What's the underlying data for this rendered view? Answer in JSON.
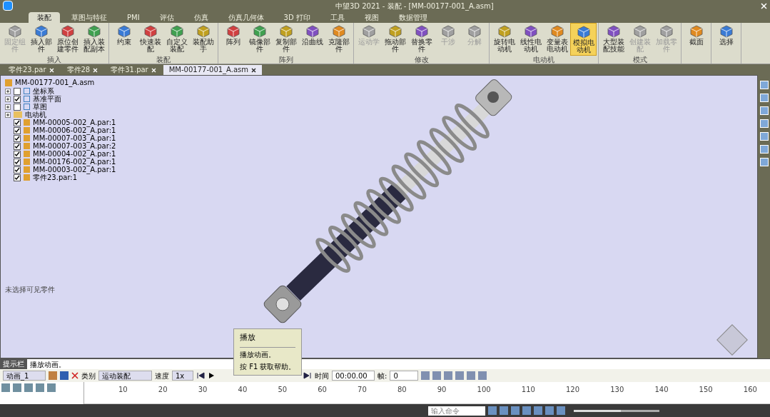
{
  "window": {
    "title": "中望3D 2021 - 装配 - [MM-00177-001_A.asm]"
  },
  "menu_tabs": [
    {
      "label": "装配",
      "selected": true
    },
    {
      "label": "草图与特征",
      "selected": false
    },
    {
      "label": "PMI",
      "selected": false
    },
    {
      "label": "评估",
      "selected": false
    },
    {
      "label": "仿真",
      "selected": false
    },
    {
      "label": "仿真几何体",
      "selected": false
    },
    {
      "label": "3D 打印",
      "selected": false
    },
    {
      "label": "工具",
      "selected": false
    },
    {
      "label": "视图",
      "selected": false
    },
    {
      "label": "数据管理",
      "selected": false
    }
  ],
  "ribbon_groups": [
    {
      "label": "插入",
      "buttons": [
        {
          "label": "固定组件",
          "disabled": true,
          "active": false
        },
        {
          "label": "插入部件",
          "disabled": false,
          "active": false
        },
        {
          "label": "原位创建零件",
          "disabled": false,
          "active": false
        },
        {
          "label": "插入装配副本",
          "disabled": false,
          "active": false
        }
      ]
    },
    {
      "label": "装配",
      "buttons": [
        {
          "label": "约束",
          "disabled": false,
          "active": false
        },
        {
          "label": "快速装配",
          "disabled": false,
          "active": false
        },
        {
          "label": "自定义装配",
          "disabled": false,
          "active": false
        },
        {
          "label": "装配助手",
          "disabled": false,
          "active": false
        }
      ]
    },
    {
      "label": "阵列",
      "buttons": [
        {
          "label": "阵列",
          "disabled": false,
          "active": false
        },
        {
          "label": "镜像部件",
          "disabled": false,
          "active": false
        },
        {
          "label": "复制部件",
          "disabled": false,
          "active": false
        },
        {
          "label": "沿曲线",
          "disabled": false,
          "active": false
        },
        {
          "label": "克隆部件",
          "disabled": false,
          "active": false
        }
      ]
    },
    {
      "label": "修改",
      "buttons": [
        {
          "label": "运动学",
          "disabled": true,
          "active": false
        },
        {
          "label": "拖动部件",
          "disabled": false,
          "active": false
        },
        {
          "label": "替换零件",
          "disabled": false,
          "active": false
        },
        {
          "label": "干涉",
          "disabled": true,
          "active": false
        },
        {
          "label": "分解",
          "disabled": true,
          "active": false
        }
      ]
    },
    {
      "label": "电动机",
      "buttons": [
        {
          "label": "旋转电动机",
          "disabled": false,
          "active": false
        },
        {
          "label": "线性电动机",
          "disabled": false,
          "active": false
        },
        {
          "label": "变量表电动机",
          "disabled": false,
          "active": false
        },
        {
          "label": "模拟电动机",
          "disabled": false,
          "active": true
        }
      ]
    },
    {
      "label": "模式",
      "buttons": [
        {
          "label": "大型装配技能",
          "disabled": false,
          "active": false
        },
        {
          "label": "创建装配",
          "disabled": true,
          "active": false
        },
        {
          "label": "加载零件",
          "disabled": true,
          "active": false
        }
      ]
    },
    {
      "buttons": [
        {
          "label": "截面",
          "disabled": false,
          "active": false
        }
      ]
    },
    {
      "buttons": [
        {
          "label": "选择",
          "disabled": false,
          "active": false
        }
      ]
    }
  ],
  "documents": [
    {
      "label": "零件23.par",
      "selected": false
    },
    {
      "label": "零件28",
      "selected": false
    },
    {
      "label": "零件31.par",
      "selected": false
    },
    {
      "label": "MM-00177-001_A.asm",
      "selected": true
    }
  ],
  "tree": {
    "label": "MM-00177-001_A.asm",
    "children": [
      {
        "label": "坐标系",
        "kind": "feature",
        "checked": false
      },
      {
        "label": "基准平面",
        "kind": "feature",
        "checked": true
      },
      {
        "label": "草图",
        "kind": "feature",
        "checked": false
      },
      {
        "label": "电动机",
        "kind": "folder"
      },
      {
        "label": "MM-00005-002_A.par:1",
        "kind": "part",
        "checked": true
      },
      {
        "label": "MM-00006-002_A.par:1",
        "kind": "part",
        "checked": true
      },
      {
        "label": "MM-00007-003_A.par:1",
        "kind": "part",
        "checked": true
      },
      {
        "label": "MM-00007-003_A.par:2",
        "kind": "part",
        "checked": true
      },
      {
        "label": "MM-00004-002_A.par:1",
        "kind": "part",
        "checked": true
      },
      {
        "label": "MM-00176-002_A.par:1",
        "kind": "part",
        "checked": true
      },
      {
        "label": "MM-00003-002_A.par:1",
        "kind": "part",
        "checked": true
      },
      {
        "label": "零件23.par:1",
        "kind": "part",
        "checked": true
      }
    ]
  },
  "viewport_label": "未选择可见零件",
  "tooltip": {
    "title": "播放",
    "lines": [
      "播放动画。",
      "按 F1 获取帮助。"
    ]
  },
  "prompt": {
    "title": "提示栏",
    "text": "播放动画。"
  },
  "animation": {
    "name": "动画_1",
    "category_label": "类别",
    "category": "运动装配",
    "speed_label": "速度",
    "speed": "1x",
    "time_label": "时间",
    "time": "00:00.00",
    "frame_label": "帧:",
    "frame": "0"
  },
  "timeline": {
    "ticks": [
      "10",
      "20",
      "30",
      "40",
      "50",
      "60",
      "70",
      "80",
      "90",
      "100",
      "110",
      "120",
      "130",
      "140",
      "150",
      "160"
    ]
  },
  "status_bar": {
    "command_placeholder": "输入命令",
    "zoom": {
      "level": 0.55
    }
  }
}
